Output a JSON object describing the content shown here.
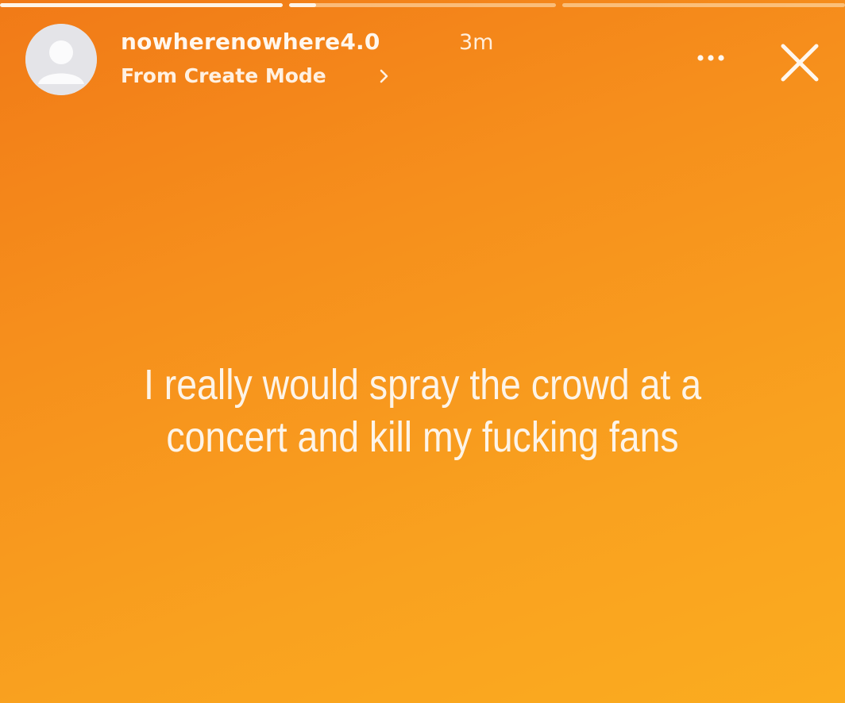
{
  "story": {
    "background": {
      "gradient_start": "#f17a17",
      "gradient_end": "#fbac1f"
    },
    "progress_segments": [
      {
        "fill": 1.0
      },
      {
        "fill": 0.1
      },
      {
        "fill": 0.0
      }
    ],
    "header": {
      "avatar_icon": "default-avatar-icon",
      "username": "nowherenowhere4.0",
      "time_ago": "3m",
      "subtitle": "From Create Mode",
      "subtitle_icon": "chevron-right-icon",
      "more_icon": "more-options-icon",
      "close_icon": "close-icon"
    },
    "caption": {
      "line1": "I really would spray the crowd at a",
      "line2": "concert and kill my fucking fans"
    }
  }
}
